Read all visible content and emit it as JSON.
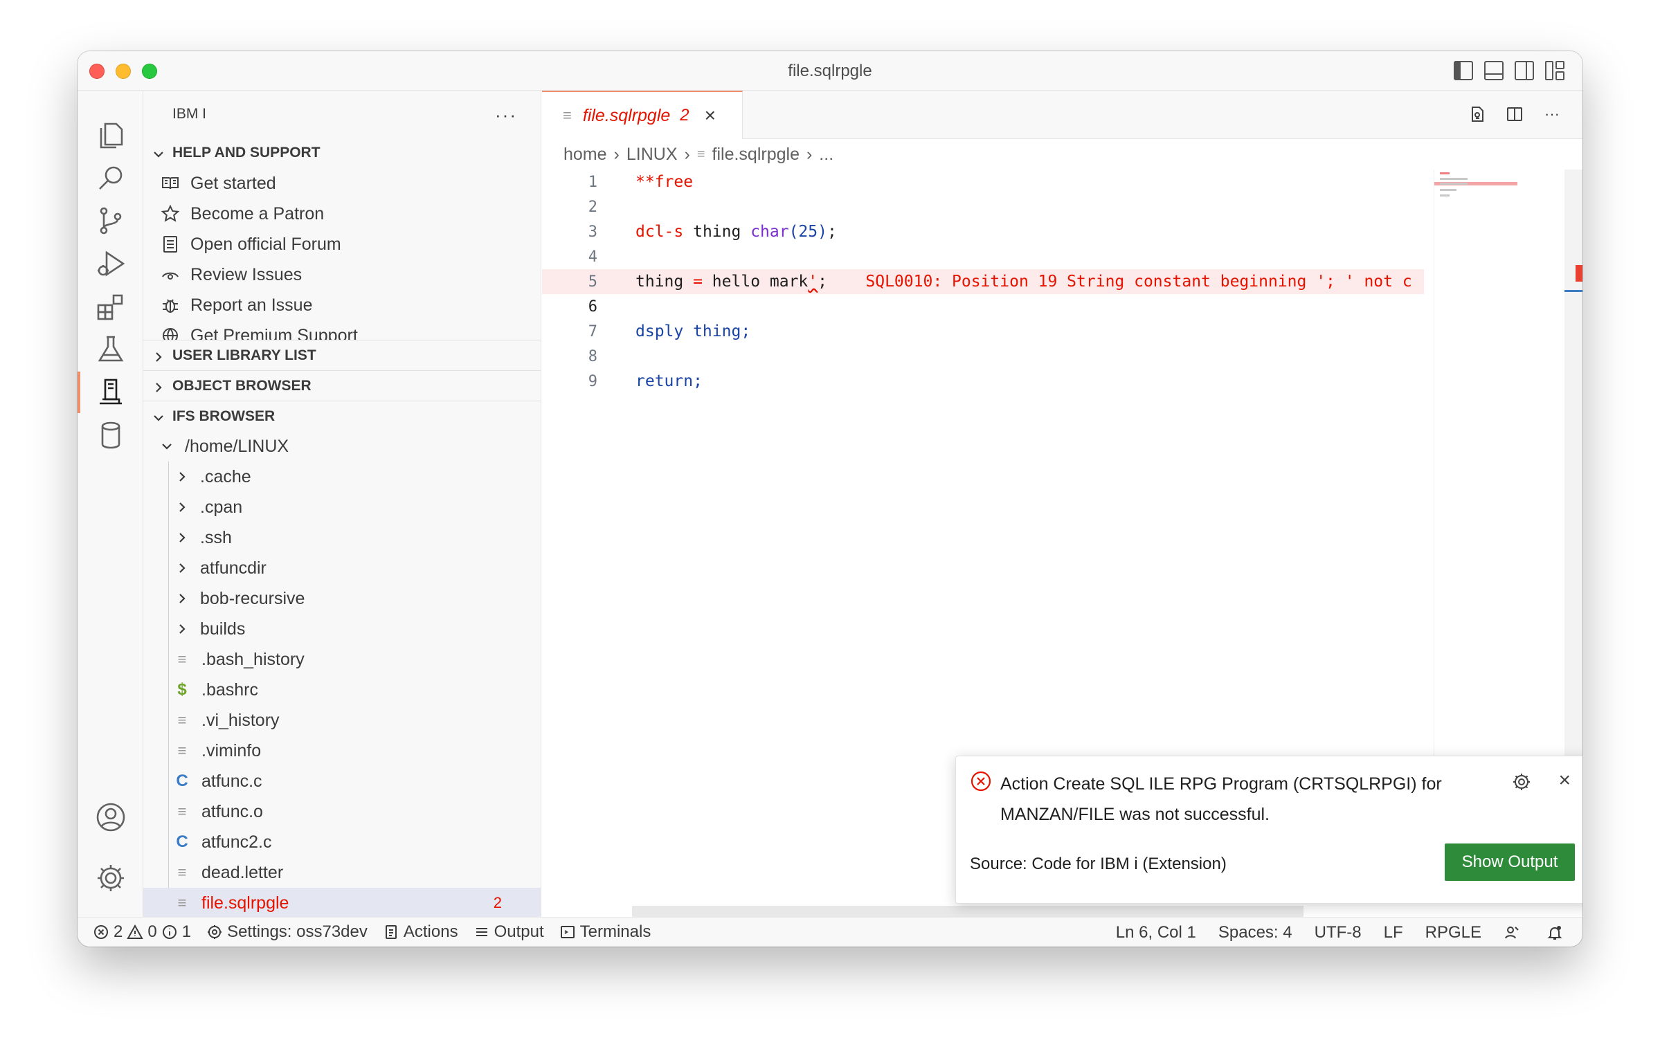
{
  "window": {
    "title": "file.sqlrpgle"
  },
  "sidebar": {
    "title": "IBM I",
    "more": "···",
    "help_section": {
      "label": "HELP AND SUPPORT",
      "items": [
        {
          "label": "Get started",
          "icon": "book-icon"
        },
        {
          "label": "Become a Patron",
          "icon": "star-icon"
        },
        {
          "label": "Open official Forum",
          "icon": "notebook-icon"
        },
        {
          "label": "Review Issues",
          "icon": "eye-icon"
        },
        {
          "label": "Report an Issue",
          "icon": "bug-icon"
        },
        {
          "label": "Get Premium Support",
          "icon": "globe-icon"
        }
      ]
    },
    "user_library": {
      "label": "USER LIBRARY LIST"
    },
    "object_browser": {
      "label": "OBJECT BROWSER"
    },
    "ifs_browser": {
      "label": "IFS BROWSER",
      "root": "/home/LINUX",
      "folders": [
        ".cache",
        ".cpan",
        ".ssh",
        "atfuncdir",
        "bob-recursive",
        "builds"
      ],
      "files": [
        {
          "name": ".bash_history",
          "icon": "≡"
        },
        {
          "name": ".bashrc",
          "icon": "$"
        },
        {
          "name": ".vi_history",
          "icon": "≡"
        },
        {
          "name": ".viminfo",
          "icon": "≡"
        },
        {
          "name": "atfunc.c",
          "icon": "C"
        },
        {
          "name": "atfunc.o",
          "icon": "≡"
        },
        {
          "name": "atfunc2.c",
          "icon": "C"
        },
        {
          "name": "dead.letter",
          "icon": "≡"
        },
        {
          "name": "file.sqlrpgle",
          "icon": "≡",
          "badge": "2"
        }
      ]
    }
  },
  "editor": {
    "tab": {
      "name": "file.sqlrpgle",
      "problems": "2",
      "close": "×"
    },
    "breadcrumbs": [
      "home",
      "LINUX",
      "file.sqlrpgle",
      "..."
    ],
    "lines": {
      "l1": {
        "num": "1",
        "t1": "**free"
      },
      "l2": {
        "num": "2"
      },
      "l3": {
        "num": "3",
        "t1": "dcl-s",
        "t2": " thing ",
        "t3": "char",
        "t4": "(25)",
        "t5": ";"
      },
      "l4": {
        "num": "4"
      },
      "l5": {
        "num": "5",
        "t1": "thing ",
        "t2": "=",
        "t3": " hello mark",
        "t4": "'",
        "t5": ";",
        "err": "SQL0010: Position 19 String constant beginning '; ' not c"
      },
      "l6": {
        "num": "6"
      },
      "l7": {
        "num": "7",
        "t1": "dsply thing;"
      },
      "l8": {
        "num": "8"
      },
      "l9": {
        "num": "9",
        "t1": "return;"
      }
    }
  },
  "notification": {
    "message": "Action Create SQL ILE RPG Program (CRTSQLRPGI) for MANZAN/FILE was not successful.",
    "source": "Source: Code for IBM i (Extension)",
    "button": "Show Output",
    "close": "×"
  },
  "statusbar": {
    "errors": "2",
    "warnings": "0",
    "infos": "1",
    "settings": "Settings: oss73dev",
    "actions": "Actions",
    "output": "Output",
    "terminals": "Terminals",
    "position": "Ln 6, Col 1",
    "spaces": "Spaces: 4",
    "encoding": "UTF-8",
    "eol": "LF",
    "language": "RPGLE"
  }
}
